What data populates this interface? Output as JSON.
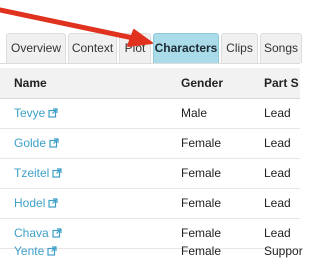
{
  "tabs": [
    {
      "label": "Overview",
      "active": false
    },
    {
      "label": "Context",
      "active": false
    },
    {
      "label": "Plot",
      "active": false
    },
    {
      "label": "Characters",
      "active": true
    },
    {
      "label": "Clips",
      "active": false
    },
    {
      "label": "Songs",
      "active": false
    }
  ],
  "table": {
    "headers": {
      "name": "Name",
      "gender": "Gender",
      "part_size": "Part S"
    },
    "rows": [
      {
        "name": "Tevye",
        "gender": "Male",
        "part_size": "Lead"
      },
      {
        "name": "Golde",
        "gender": "Female",
        "part_size": "Lead"
      },
      {
        "name": "Tzeitel",
        "gender": "Female",
        "part_size": "Lead"
      },
      {
        "name": "Hodel",
        "gender": "Female",
        "part_size": "Lead"
      },
      {
        "name": "Chava",
        "gender": "Female",
        "part_size": "Lead"
      },
      {
        "name": "Yente",
        "gender": "Female",
        "part_size": "Suppor"
      }
    ]
  },
  "colors": {
    "accent": "#3ea0c8",
    "active_tab": "#a9dbe8",
    "arrow": "#e0321e"
  },
  "icons": {
    "row_link": "external-link-icon",
    "annotation": "red-arrow"
  }
}
